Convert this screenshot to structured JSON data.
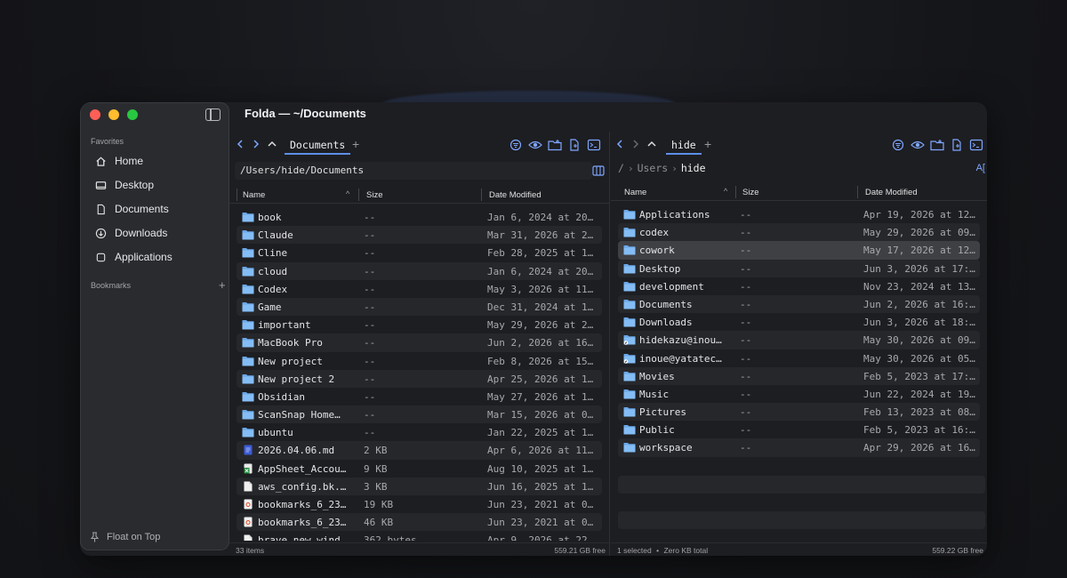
{
  "window": {
    "title": "Folda — ~/Documents"
  },
  "sidebar": {
    "favorites_label": "Favorites",
    "items": [
      {
        "label": "Home",
        "icon": "house-icon"
      },
      {
        "label": "Desktop",
        "icon": "display-icon"
      },
      {
        "label": "Documents",
        "icon": "document-icon"
      },
      {
        "label": "Downloads",
        "icon": "download-icon"
      },
      {
        "label": "Applications",
        "icon": "applications-icon"
      }
    ],
    "bookmarks_label": "Bookmarks",
    "float_label": "Float on Top"
  },
  "left": {
    "tab": "Documents",
    "path": "/Users/hide/Documents",
    "headers": {
      "name": "Name",
      "size": "Size",
      "date": "Date Modified"
    },
    "rows": [
      {
        "name": "book",
        "size": "--",
        "date": "Jan 6, 2024 at 20…",
        "type": "folder"
      },
      {
        "name": "Claude",
        "size": "--",
        "date": "Mar 31, 2026 at 2…",
        "type": "folder"
      },
      {
        "name": "Cline",
        "size": "--",
        "date": "Feb 28, 2025 at 1…",
        "type": "folder"
      },
      {
        "name": "cloud",
        "size": "--",
        "date": "Jan 6, 2024 at 20…",
        "type": "folder"
      },
      {
        "name": "Codex",
        "size": "--",
        "date": "May 3, 2026 at 11…",
        "type": "folder"
      },
      {
        "name": "Game",
        "size": "--",
        "date": "Dec 31, 2024 at 1…",
        "type": "folder"
      },
      {
        "name": "important",
        "size": "--",
        "date": "May 29, 2026 at 2…",
        "type": "folder"
      },
      {
        "name": "MacBook Pro",
        "size": "--",
        "date": "Jun 2, 2026 at 16…",
        "type": "folder"
      },
      {
        "name": "New project",
        "size": "--",
        "date": "Feb 8, 2026 at 15…",
        "type": "folder"
      },
      {
        "name": "New project 2",
        "size": "--",
        "date": "Apr 25, 2026 at 1…",
        "type": "folder"
      },
      {
        "name": "Obsidian",
        "size": "--",
        "date": "May 27, 2026 at 1…",
        "type": "folder"
      },
      {
        "name": "ScanSnap Home…",
        "size": "--",
        "date": "Mar 15, 2026 at 0…",
        "type": "folder"
      },
      {
        "name": "ubuntu",
        "size": "--",
        "date": "Jan 22, 2025 at 1…",
        "type": "folder"
      },
      {
        "name": "2026.04.06.md",
        "size": "2 KB",
        "date": "Apr 6, 2026 at 11…",
        "type": "md"
      },
      {
        "name": "AppSheet_Accou…",
        "size": "9 KB",
        "date": "Aug 10, 2025 at 1…",
        "type": "xls"
      },
      {
        "name": "aws_config.bk.…",
        "size": "3 KB",
        "date": "Jun 16, 2025 at 1…",
        "type": "file"
      },
      {
        "name": "bookmarks_6_23…",
        "size": "19 KB",
        "date": "Jun 23, 2021 at 0…",
        "type": "html"
      },
      {
        "name": "bookmarks_6_23…",
        "size": "46 KB",
        "date": "Jun 23, 2021 at 0…",
        "type": "html"
      },
      {
        "name": "brave_new_wind…",
        "size": "362 bytes",
        "date": "Apr 9, 2026 at 22…",
        "type": "file"
      }
    ],
    "status_left": "33 items",
    "status_right": "559.21 GB free"
  },
  "right": {
    "tab": "hide",
    "crumbs": [
      "/",
      "Users",
      "hide"
    ],
    "headers": {
      "name": "Name",
      "size": "Size",
      "date": "Date Modified"
    },
    "rows": [
      {
        "name": "Applications",
        "size": "--",
        "date": "Apr 19, 2026 at 12…",
        "type": "folder"
      },
      {
        "name": "codex",
        "size": "--",
        "date": "May 29, 2026 at 09…",
        "type": "folder"
      },
      {
        "name": "cowork",
        "size": "--",
        "date": "May 17, 2026 at 12…",
        "type": "folder",
        "selected": true
      },
      {
        "name": "Desktop",
        "size": "--",
        "date": "Jun 3, 2026 at 17:…",
        "type": "folder"
      },
      {
        "name": "development",
        "size": "--",
        "date": "Nov 23, 2024 at 13…",
        "type": "folder"
      },
      {
        "name": "Documents",
        "size": "--",
        "date": "Jun 2, 2026 at 16:…",
        "type": "folder"
      },
      {
        "name": "Downloads",
        "size": "--",
        "date": "Jun 3, 2026 at 18:…",
        "type": "folder"
      },
      {
        "name": "hidekazu@inou…",
        "size": "--",
        "date": "May 30, 2026 at 09…",
        "type": "alias"
      },
      {
        "name": "inoue@yatatec…",
        "size": "--",
        "date": "May 30, 2026 at 05…",
        "type": "alias"
      },
      {
        "name": "Movies",
        "size": "--",
        "date": "Feb 5, 2023 at 17:…",
        "type": "folder"
      },
      {
        "name": "Music",
        "size": "--",
        "date": "Jun 22, 2024 at 19…",
        "type": "folder"
      },
      {
        "name": "Pictures",
        "size": "--",
        "date": "Feb 13, 2023 at 08…",
        "type": "folder"
      },
      {
        "name": "Public",
        "size": "--",
        "date": "Feb 5, 2023 at 16:…",
        "type": "folder"
      },
      {
        "name": "workspace",
        "size": "--",
        "date": "Apr 29, 2026 at 16…",
        "type": "folder"
      }
    ],
    "status_left": "1 selected",
    "status_sep": "•",
    "status_mid": "Zero KB total",
    "status_right": "559.22 GB free"
  }
}
